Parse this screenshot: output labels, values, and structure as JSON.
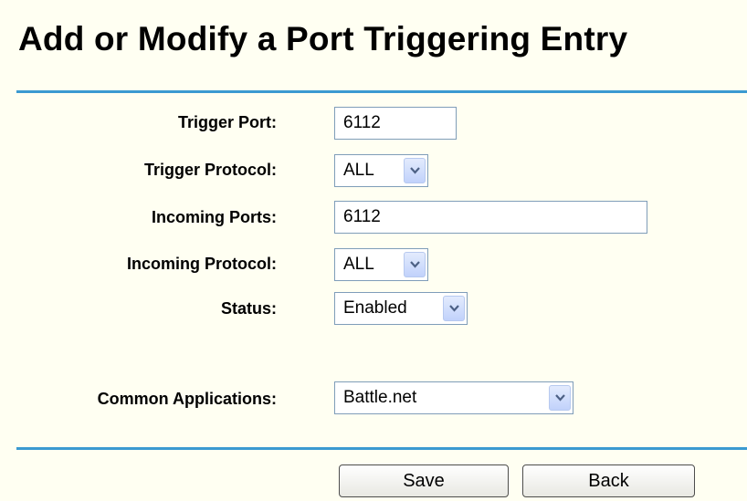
{
  "title": "Add or Modify a Port Triggering Entry",
  "form": {
    "trigger_port": {
      "label": "Trigger Port:",
      "value": "6112"
    },
    "trigger_protocol": {
      "label": "Trigger Protocol:",
      "value": "ALL"
    },
    "incoming_ports": {
      "label": "Incoming Ports:",
      "value": "6112"
    },
    "incoming_protocol": {
      "label": "Incoming Protocol:",
      "value": "ALL"
    },
    "status": {
      "label": "Status:",
      "value": "Enabled"
    },
    "common_applications": {
      "label": "Common Applications:",
      "value": "Battle.net"
    }
  },
  "buttons": {
    "save": "Save",
    "back": "Back"
  },
  "icons": {
    "dropdown": "chevron-down-icon"
  },
  "colors": {
    "background": "#fffff2",
    "rule": "#3b9ad1",
    "field_border": "#7f9db9",
    "arrow": "#4d6185"
  }
}
